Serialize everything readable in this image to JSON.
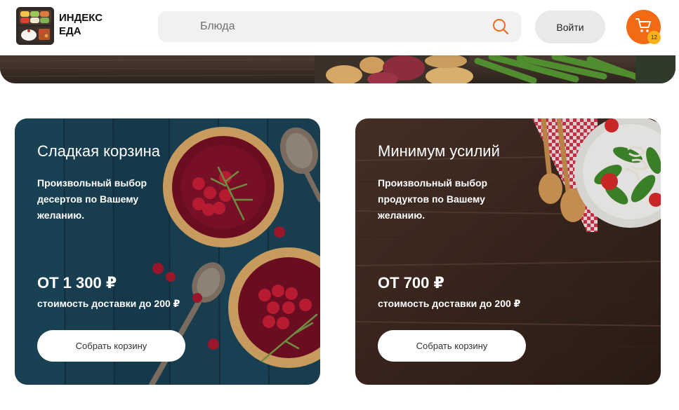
{
  "header": {
    "logo_line1": "ИНДЕКС",
    "logo_line2": "ЕДА",
    "search_placeholder": "Блюда",
    "login_label": "Войти",
    "cart_count": "12"
  },
  "cards": [
    {
      "title": "Сладкая корзина",
      "description": "Произвольный выбор десертов по Вашему желанию.",
      "price": "ОТ 1 300 ₽",
      "delivery": "стоимость доставки до 200 ₽",
      "button": "Собрать корзину"
    },
    {
      "title": "Минимум усилий",
      "description": "Произвольный выбор продуктов по Вашему желанию.",
      "price": "ОТ 700 ₽",
      "delivery": "стоимость доставки до 200 ₽",
      "button": "Собрать корзину"
    }
  ],
  "colors": {
    "accent": "#f26b14",
    "badge": "#f7b21a",
    "search_bg": "#f1f1f1",
    "login_bg": "#e9e9e9"
  },
  "icons": {
    "search": "search-icon",
    "cart": "cart-icon"
  }
}
